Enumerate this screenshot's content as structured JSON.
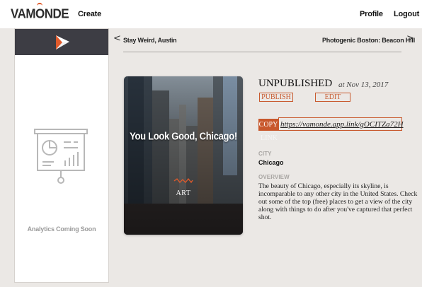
{
  "header": {
    "logo_text_left": "VAM",
    "logo_text_o": "O",
    "logo_text_right": "NDE",
    "create_label": "Create",
    "profile_label": "Profile",
    "logout_label": "Logout"
  },
  "sidebar": {
    "analytics_label": "Analytics Coming Soon"
  },
  "breadcrumb": {
    "prev_arrow": "<",
    "prev_label": "Stay Weird, Austin",
    "next_label": "Photogenic Boston: Beacon Hill",
    "next_arrow": ">"
  },
  "card": {
    "title": "You Look Good, Chicago!",
    "category": "ART"
  },
  "details": {
    "status": "UNPUBLISHED",
    "date": "at Nov 13, 2017",
    "publish_label": "PUBLISH",
    "edit_label": "EDIT",
    "copy_label": "COPY",
    "copy_link_word": "LINK",
    "link_url": "https://vamonde.app.link/gOCITZa72H",
    "city_label": "CITY",
    "city_value": "Chicago",
    "overview_label": "OVERVIEW",
    "overview_text": "The beauty of Chicago, especially its skyline, is incomparable to any other city in the United States. Check out some of the top (free) places to get a view of the city along with things to do after you've captured that perfect shot."
  },
  "colors": {
    "accent": "#c8582c",
    "sidebar_head": "#3d3d44",
    "background": "#ebe8e5"
  }
}
